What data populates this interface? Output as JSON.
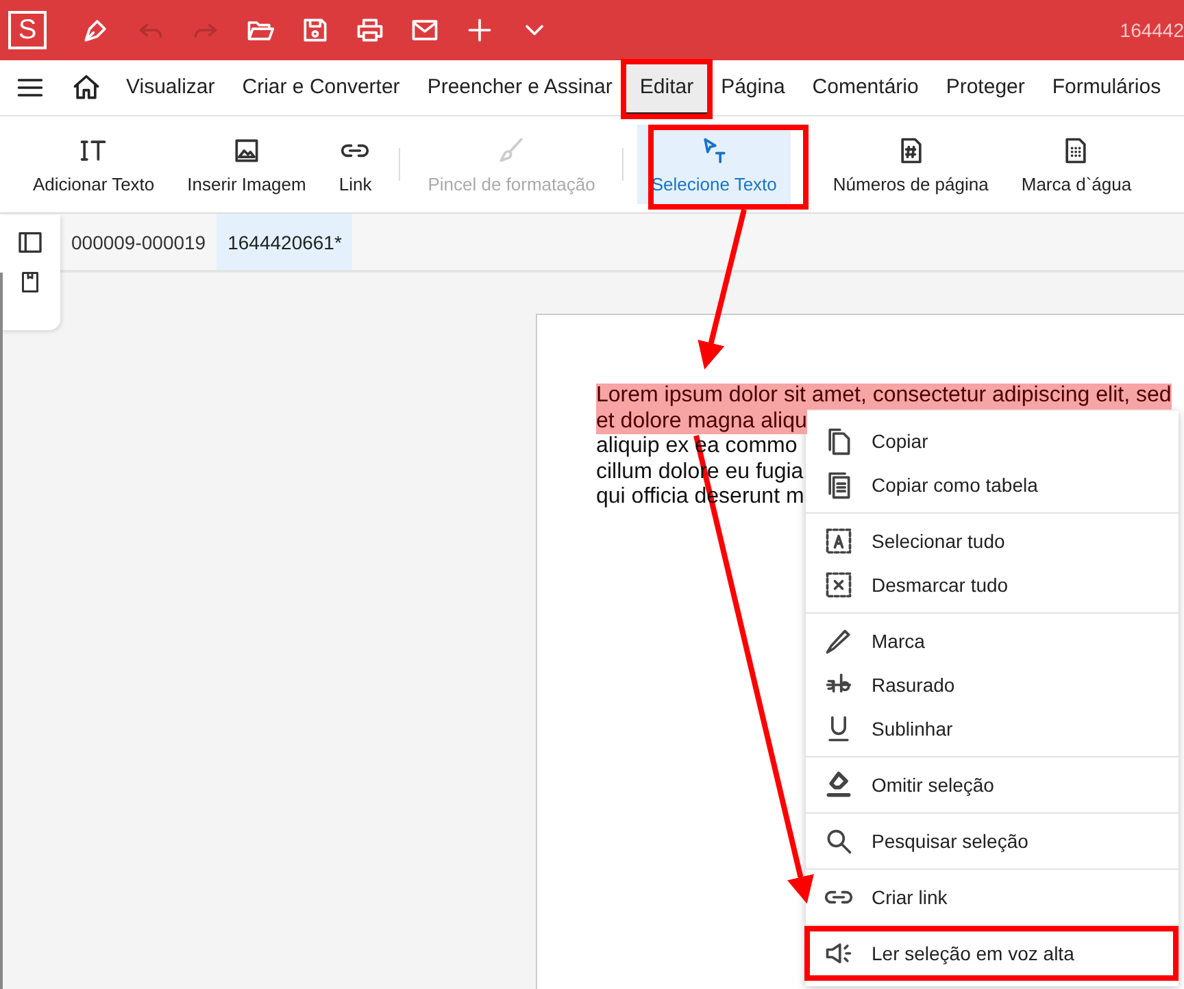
{
  "title_bar": {
    "logo": "S",
    "title": "164442",
    "quick_access": [
      {
        "disabled": false
      },
      {
        "disabled": true
      },
      {
        "disabled": true
      },
      {
        "disabled": false
      },
      {
        "disabled": false
      },
      {
        "disabled": false
      },
      {
        "disabled": false
      },
      {
        "disabled": false
      },
      {
        "disabled": false
      }
    ]
  },
  "menu_tabs": [
    {
      "label": "Visualizar",
      "selected": false
    },
    {
      "label": "Criar e Converter",
      "selected": false
    },
    {
      "label": "Preencher e Assinar",
      "selected": false
    },
    {
      "label": "Editar",
      "selected": true
    },
    {
      "label": "Página",
      "selected": false
    },
    {
      "label": "Comentário",
      "selected": false
    },
    {
      "label": "Proteger",
      "selected": false
    },
    {
      "label": "Formulários",
      "selected": false
    }
  ],
  "ribbon": [
    {
      "label": "Adicionar Texto",
      "selected": false,
      "disabled": false
    },
    {
      "label": "Inserir Imagem",
      "selected": false,
      "disabled": false
    },
    {
      "label": "Link",
      "selected": false,
      "disabled": false
    },
    {
      "label": "Pincel de formatação",
      "selected": false,
      "disabled": true
    },
    {
      "label": "Selecione Texto",
      "selected": true,
      "disabled": false
    },
    {
      "label": "Números de página",
      "selected": false,
      "disabled": false
    },
    {
      "label": "Marca d`água",
      "selected": false,
      "disabled": false
    }
  ],
  "document_tabs": [
    {
      "label": "000009-000019",
      "selected": false
    },
    {
      "label": "1644420661*",
      "selected": true
    }
  ],
  "document": {
    "lines": [
      {
        "text": "Lorem ipsum dolor sit amet, consectetur adipiscing elit, sed",
        "selected": true
      },
      {
        "text": "et dolore magna aliqu",
        "selected": true
      },
      {
        "text": "aliquip ex ea commo",
        "selected": false
      },
      {
        "text": "cillum dolore eu fugia",
        "selected": false
      },
      {
        "text": "qui officia deserunt m",
        "selected": false
      }
    ]
  },
  "context_menu": {
    "groups": [
      [
        {
          "label": "Copiar"
        },
        {
          "label": "Copiar como tabela"
        }
      ],
      [
        {
          "label": "Selecionar tudo"
        },
        {
          "label": "Desmarcar tudo"
        }
      ],
      [
        {
          "label": "Marca"
        },
        {
          "label": "Rasurado"
        },
        {
          "label": "Sublinhar"
        }
      ],
      [
        {
          "label": "Omitir seleção"
        }
      ],
      [
        {
          "label": "Pesquisar seleção"
        }
      ],
      [
        {
          "label": "Criar link"
        }
      ],
      [
        {
          "label": "Ler seleção em voz alta"
        }
      ]
    ]
  }
}
